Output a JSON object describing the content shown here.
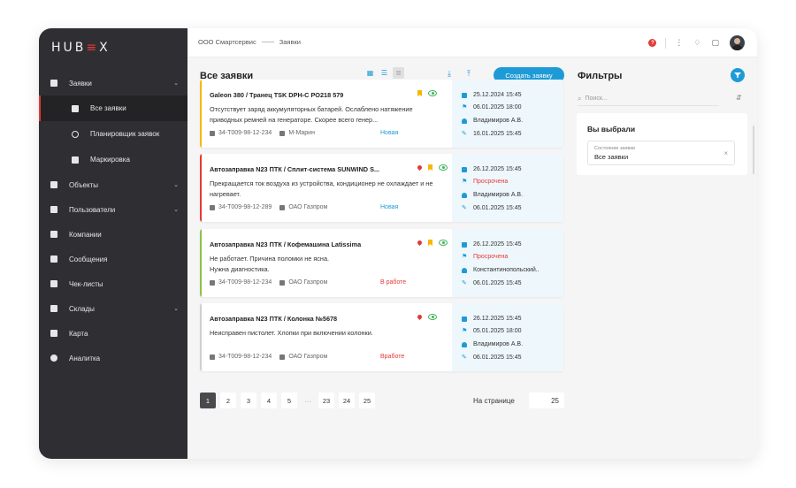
{
  "app": {
    "logo_text": "HUB",
    "logo_accent": "≡",
    "logo_tail": "X"
  },
  "breadcrumb": {
    "org": "ООО Смартсервис",
    "page": "Заявки"
  },
  "sidebar": {
    "items": [
      {
        "label": "Заявки",
        "icon": "clipboard-icon",
        "caret": "⌄"
      },
      {
        "label": "Все заявки",
        "icon": "list-icon",
        "active": true
      },
      {
        "label": "Планировщик заявок",
        "icon": "clock-icon"
      },
      {
        "label": "Маркировка",
        "icon": "qr-icon"
      },
      {
        "label": "Объекты",
        "icon": "wrench-icon",
        "caret": "⌄"
      },
      {
        "label": "Пользователи",
        "icon": "users-icon",
        "caret": "⌄"
      },
      {
        "label": "Компании",
        "icon": "briefcase-icon"
      },
      {
        "label": "Сообщения",
        "icon": "message-icon"
      },
      {
        "label": "Чек-листы",
        "icon": "checklist-icon"
      },
      {
        "label": "Склады",
        "icon": "warehouse-icon",
        "caret": "⌄"
      },
      {
        "label": "Карта",
        "icon": "map-icon"
      },
      {
        "label": "Аналитка",
        "icon": "pie-icon"
      }
    ]
  },
  "list": {
    "title": "Все заявки",
    "create_label": "Создать заявку"
  },
  "cards": [
    {
      "bar_color": "#f5b800",
      "title": "Galeon 380 / Транец TSK DPH-C  PO218 579",
      "desc": "Отсутствует заряд аккумуляторных батарей. Ослаблено натяжение приводных ремней на генераторе. Скорее всего генер...",
      "code": "34-Т009-98-12-234",
      "company": "М-Марин",
      "status": "Новая",
      "status_color": "#1e9bd7",
      "pin": false,
      "flag": true,
      "eye": true,
      "created": "25.12.2024  15:45",
      "deadline": "06.01.2025 18:00",
      "deadline_color": "#333",
      "assignee": "Владимиров А.В.",
      "updated": "16.01.2025  15:45"
    },
    {
      "bar_color": "#e53935",
      "title": "Автозаправка N23 ПТК / Сплит-система SUNWIND S...",
      "desc": "Прекращается ток воздуха из устройства,  кондиционер не охлаждает и не нагревает.",
      "code": "34-Т009-98-12-289",
      "company": "ОАО Газпром",
      "status": "Новая",
      "status_color": "#1e9bd7",
      "pin": true,
      "flag": true,
      "eye": true,
      "created": "26.12.2025  15:45",
      "deadline": "Просрочена",
      "deadline_color": "#e53935",
      "assignee": "Владимиров А.В.",
      "updated": "06.01.2025  15:45"
    },
    {
      "bar_color": "#8bc34a",
      "title": "Автозаправка N23 ПТК / Кофемашина Latissima",
      "desc": "Не работает. Причина поломки не ясна.\nНужна диагностика.",
      "code": "34-Т009-98-12-234",
      "company": "ОАО Газпром",
      "status": "В работе",
      "status_color": "#e53935",
      "pin": true,
      "flag": true,
      "eye": true,
      "created": "26.12.2025  15:45",
      "deadline": "Просрочена",
      "deadline_color": "#e53935",
      "assignee": "Константинопольский..",
      "updated": "06.01.2025  15:45"
    },
    {
      "bar_color": "#cfcfcf",
      "title": "Автозаправка N23 ПТК / Колонка №5678",
      "desc": "Неисправен пистолет. Хлопки при включении колонки.",
      "code": "34-Т009-98-12-234",
      "company": "ОАО Газпром",
      "status": "Вработе",
      "status_color": "#e53935",
      "pin": true,
      "flag": false,
      "eye": true,
      "created": "26.12.2025  15:45",
      "deadline": "05.01.2025 18:00",
      "deadline_color": "#333",
      "assignee": "Владимиров А.В.",
      "updated": "06.01.2025  15:45"
    }
  ],
  "pagination": {
    "pages": [
      "1",
      "2",
      "3",
      "4",
      "5",
      "···",
      "23",
      "24",
      "25"
    ],
    "current": "1",
    "per_page_label": "На странице",
    "per_page": "25"
  },
  "filters": {
    "title": "Фильтры",
    "search_placeholder": "Поиск...",
    "chosen_title": "Вы выбрали",
    "chip_label": "Состояние заявки",
    "chip_value": "Все заявки",
    "chip_close": "×"
  },
  "colors": {
    "accent": "#1e9bd7",
    "danger": "#e53935",
    "sidebar_bg": "#2f2f33"
  }
}
